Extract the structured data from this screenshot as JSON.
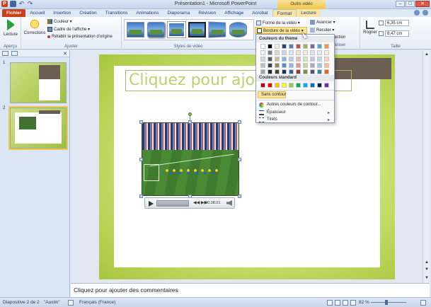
{
  "window": {
    "title": "Présentation1 - Microsoft PowerPoint",
    "context_tab_header": "Outils vidéo",
    "min": "–",
    "max": "□",
    "close": "✕"
  },
  "tabs": [
    "Fichier",
    "Accueil",
    "Insertion",
    "Création",
    "Transitions",
    "Animations",
    "Diaporama",
    "Révision",
    "Affichage",
    "Acrobat",
    "Format",
    "Lecture"
  ],
  "ribbon": {
    "apercu": {
      "button": "Lecture",
      "group": "Aperçu"
    },
    "ajuster": {
      "corrections": "Corrections",
      "couleur": "Couleur ▾",
      "cadre": "Cadre de l'affiche ▾",
      "retablir": "Rétablir la présentation d'origine",
      "group": "Ajuster"
    },
    "styles": {
      "group": "Styles de vidéo"
    },
    "format": {
      "forme": "Forme de la vidéo ▾",
      "bordure": "Bordure de la vidéo ▾",
      "avancer": "Avancer ▾",
      "reculer": "Reculer ▾",
      "selection": "lection",
      "organiser": "aniser"
    },
    "taille": {
      "rogner": "Rogner",
      "height": "6,35 cm",
      "width": "8,47 cm",
      "group": "Taille"
    }
  },
  "dropdown": {
    "theme_header": "Couleurs du thème",
    "standard_header": "Couleurs standard",
    "sans_contour": "Sans contour",
    "autres": "Autres couleurs de contour...",
    "epaisseur": "Épaisseur",
    "tirets": "Tirets",
    "theme_colors": [
      [
        "#ffffff",
        "#000000",
        "#eeece1",
        "#1f497d",
        "#4f81bd",
        "#c0504d",
        "#9bbb59",
        "#8064a2",
        "#4bacc6",
        "#f79646"
      ],
      [
        "#f2f2f2",
        "#7f7f7f",
        "#ddd9c3",
        "#c6d9f0",
        "#dbe5f1",
        "#f2dcdb",
        "#ebf1dd",
        "#e5e0ec",
        "#dbeef3",
        "#fdeada"
      ],
      [
        "#d8d8d8",
        "#595959",
        "#c4bd97",
        "#8db3e2",
        "#b8cce4",
        "#e5b9b7",
        "#d7e3bc",
        "#ccc1d9",
        "#b7dde8",
        "#fbd5b5"
      ],
      [
        "#bfbfbf",
        "#3f3f3f",
        "#938953",
        "#548dd4",
        "#95b3d7",
        "#d99694",
        "#c3d69b",
        "#b2a2c7",
        "#92cddc",
        "#fac08f"
      ],
      [
        "#a5a5a5",
        "#262626",
        "#494429",
        "#17365d",
        "#366092",
        "#953734",
        "#76923c",
        "#5f497a",
        "#31859b",
        "#e36c09"
      ],
      [
        "#7f7f7f",
        "#0c0c0c",
        "#1d1b10",
        "#0f243e",
        "#244061",
        "#632423",
        "#4f6128",
        "#3f3151",
        "#205867",
        "#974806"
      ]
    ],
    "standard_colors": [
      "#c00000",
      "#ff0000",
      "#ffc000",
      "#ffff00",
      "#92d050",
      "#00b050",
      "#00b0f0",
      "#0070c0",
      "#002060",
      "#7030a0"
    ]
  },
  "slides_pane": {
    "slide1_num": "1",
    "slide2_num": "2"
  },
  "slide": {
    "title_placeholder": "Cliquez pour ajou"
  },
  "video_controls": {
    "time": "00:38.01",
    "skip": "◀◀ ▶▶"
  },
  "notes": {
    "placeholder": "Cliquez pour ajouter des commentaires"
  },
  "status": {
    "slide": "Diapositive 2 de 2",
    "theme": "\"Austin\"",
    "language": "Français (France)",
    "zoom": "82 %"
  },
  "icons": [
    "play-icon",
    "corrections-icon",
    "color-icon",
    "frame-icon",
    "reset-icon",
    "shape-icon",
    "border-icon",
    "forward-icon",
    "backward-icon",
    "crop-icon",
    "eraser-icon",
    "weight-icon",
    "dash-icon"
  ]
}
